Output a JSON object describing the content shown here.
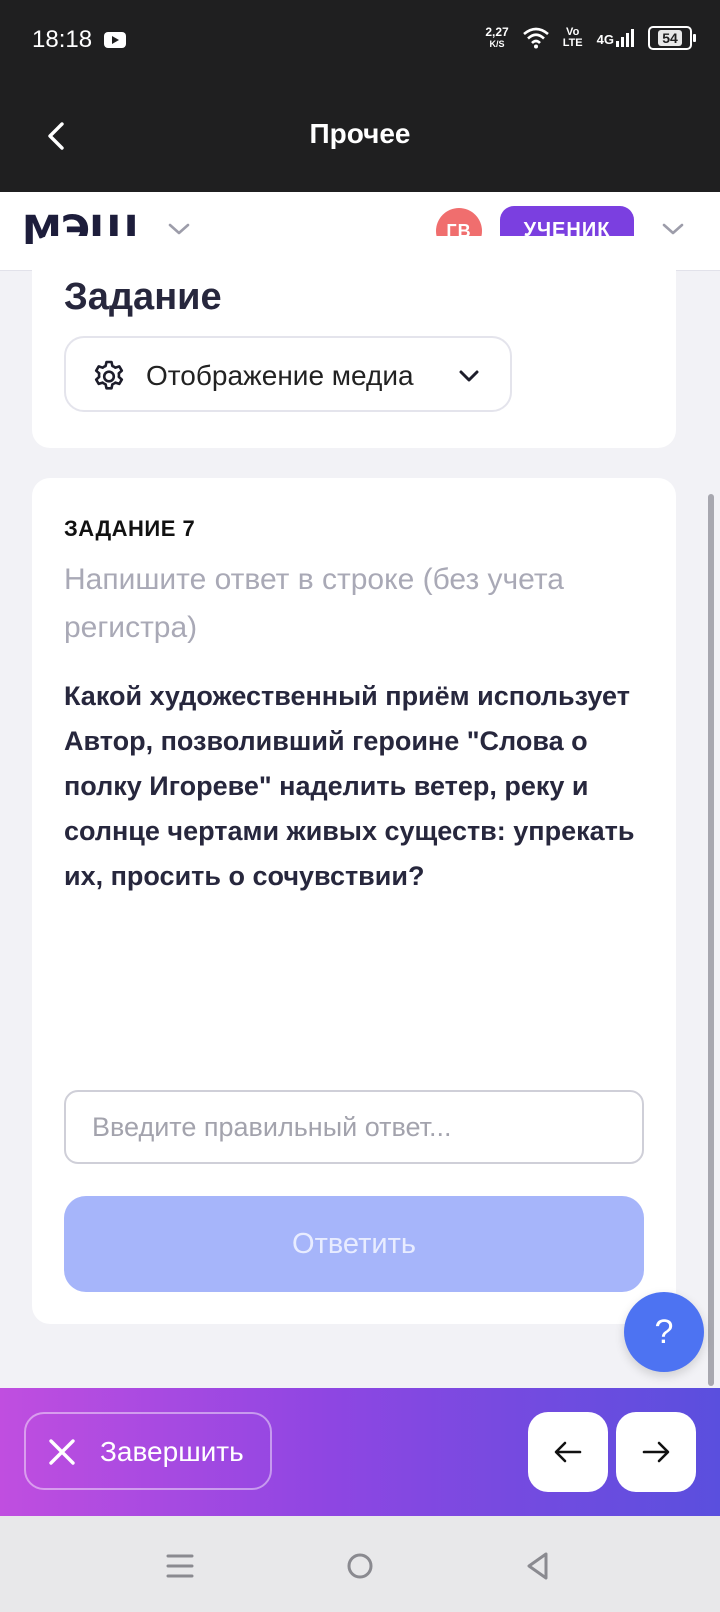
{
  "status_bar": {
    "time": "18:18",
    "speed_value": "2,27",
    "speed_unit": "K/S",
    "volte_top": "Vo",
    "volte_bottom": "LTE",
    "network": "4G",
    "battery": "54"
  },
  "app_bar": {
    "title": "Прочее"
  },
  "header": {
    "logo": "МЭШ",
    "avatar_initials": "ГВ",
    "role": "УЧЕНИК"
  },
  "task_card": {
    "heading": "Задание",
    "media_button": "Отображение медиа"
  },
  "question_card": {
    "number": "ЗАДАНИЕ 7",
    "hint": "Напишите ответ в строке (без учета регистра)",
    "question": "Какой художественный приём использует Автор, позволивший героине \"Слова о полку Игореве\" наделить ветер, реку и солнце чертами живых существ: упрекать их, просить о сочувствии?",
    "answer_placeholder": "Введите правильный ответ...",
    "answer_value": "",
    "submit_label": "Ответить"
  },
  "help_button": "?",
  "bottom_bar": {
    "finish_label": "Завершить"
  },
  "colors": {
    "role_badge": "#7b3fe0",
    "avatar": "#f06e6e",
    "submit_disabled": "#a6b5fa",
    "help_button": "#4d73f2",
    "bottom_gradient_start": "#c04ee0",
    "bottom_gradient_end": "#5a4fde"
  }
}
